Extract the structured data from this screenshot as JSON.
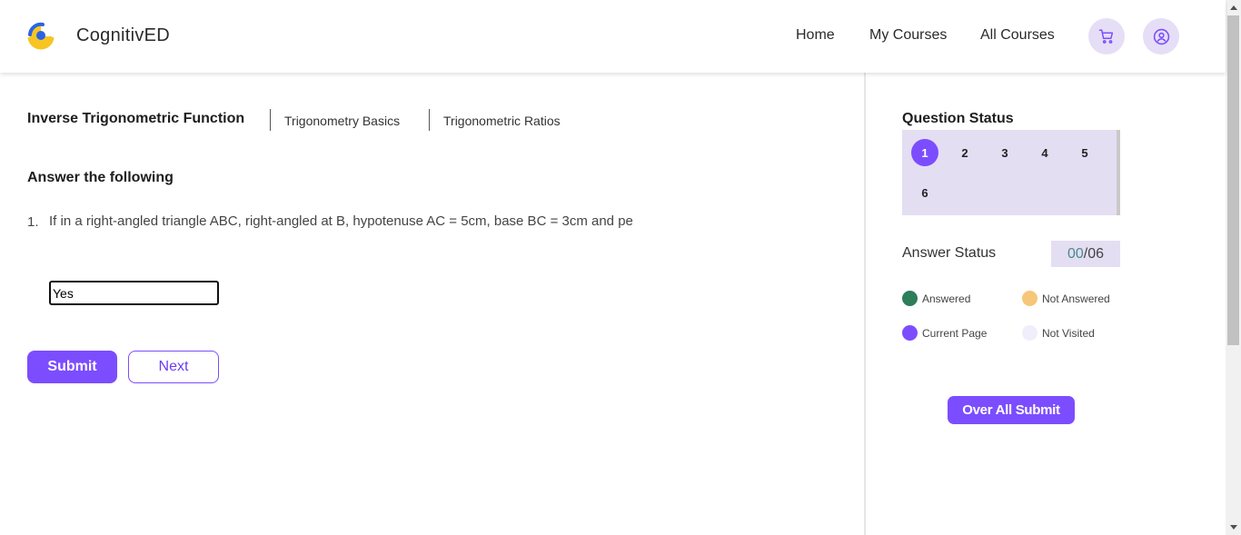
{
  "header": {
    "brand": "CognitivED",
    "nav": {
      "home": "Home",
      "my_courses": "My Courses",
      "all_courses": "All Courses"
    }
  },
  "colors": {
    "accent": "#7c4dff",
    "panel_bg": "#e4def3",
    "answered": "#2e7d5b",
    "not_answered": "#f7c679",
    "current": "#7c4dff",
    "not_visited": "#f1eefb"
  },
  "tabs": [
    {
      "label": "Inverse Trigonometric Function",
      "active": true
    },
    {
      "label": "Trigonometry Basics",
      "active": false
    },
    {
      "label": "Trigonometric Ratios",
      "active": false
    }
  ],
  "main": {
    "section_title": "Answer the following",
    "question_number": "1.",
    "question_text": "If in a right-angled triangle ABC, right-angled at B, hypotenuse AC = 5cm, base BC = 3cm and pe",
    "answer_value": "Yes",
    "submit_label": "Submit",
    "next_label": "Next"
  },
  "sidebar": {
    "question_status_title": "Question Status",
    "questions": [
      "1",
      "2",
      "3",
      "4",
      "5",
      "6"
    ],
    "current_question": "1",
    "answer_status_label": "Answer Status",
    "answered_count": "00",
    "total_count": "/06",
    "legend": {
      "answered": "Answered",
      "not_answered": "Not Answered",
      "current_page": "Current Page",
      "not_visited": "Not Visited"
    },
    "overall_submit_label": "Over All Submit"
  }
}
